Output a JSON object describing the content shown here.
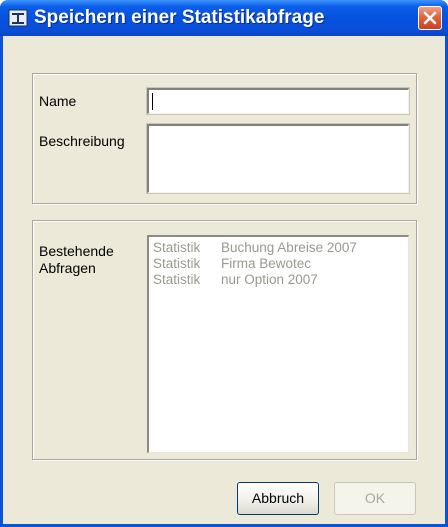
{
  "window": {
    "title": "Speichern einer Statistikabfrage"
  },
  "form": {
    "name_label": "Name",
    "name_value": "",
    "description_label": "Beschreibung",
    "description_value": ""
  },
  "existing": {
    "label": "Bestehende\nAbfragen",
    "items": [
      {
        "type": "Statistik",
        "name": "Buchung Abreise 2007"
      },
      {
        "type": "Statistik",
        "name": "Firma Bewotec"
      },
      {
        "type": "Statistik",
        "name": "nur Option 2007"
      }
    ]
  },
  "buttons": {
    "cancel_label": "Abbruch",
    "ok_label": "OK"
  },
  "colors": {
    "titlebar": "#0a52d8",
    "dialog_bg": "#ece9d8",
    "close_button": "#e3623e",
    "disabled_text": "#9a9890"
  },
  "icons": {
    "app": "dialog-app-icon",
    "close": "close-icon"
  }
}
